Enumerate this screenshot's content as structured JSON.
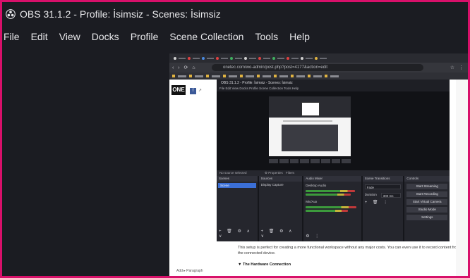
{
  "window": {
    "title": "OBS 31.1.2 - Profile: İsimsiz - Scenes: İsimsiz",
    "accent_frame_color": "#d8106a",
    "background": "#1b1c22"
  },
  "menubar": {
    "items": [
      "File",
      "Edit",
      "View",
      "Docks",
      "Profile",
      "Scene Collection",
      "Tools",
      "Help"
    ]
  },
  "preview": {
    "browser": {
      "url": "onetec.com/wo-admin/post.php?post=4177&action=edit",
      "nav_icons": "‹ › ⟳ ⌂",
      "right_icons": "☆ ⋮"
    },
    "site_logo": "ONE",
    "inner_obs": {
      "title": "OBS 31.1.2 - Profile: İsimsiz - Scenes: İsimsiz",
      "menu": "File  Edit  View  Docks  Profile  Scene Collection  Tools  Help",
      "status_left": "No source selected",
      "properties_label": "⚙ Properties",
      "filters_label": "Filters",
      "docks": {
        "scenes": {
          "header": "Scenes",
          "selected": "Scene",
          "controls": "+ 🗑 ⚙ ∧ ∨"
        },
        "sources": {
          "header": "Sources",
          "row": "Display Capture",
          "controls": "+ 🗑 ⚙ ∧ ∨"
        },
        "mixer": {
          "header": "Audio Mixer",
          "ch1": "Desktop Audio",
          "ch2": "Mic/Aux",
          "controls": "⚙ ⋮"
        },
        "transitions": {
          "header": "Scene Transitions",
          "type": "Fade",
          "duration_label": "Duration",
          "duration_value": "300 ms",
          "controls": "+ 🗑 ⋮"
        },
        "controls": {
          "header": "Controls",
          "buttons": [
            "Start Streaming",
            "Start Recording",
            "Start Virtual Camera",
            "Studio Mode",
            "Settings"
          ]
        }
      }
    },
    "article": {
      "paragraph": "This setup is perfect for creating a more functional workspace without any major costs. You can even use it to record content from the connected device.",
      "heading": "▼ The Hardware Connection"
    },
    "pager": "Add ▸ Paragraph"
  }
}
